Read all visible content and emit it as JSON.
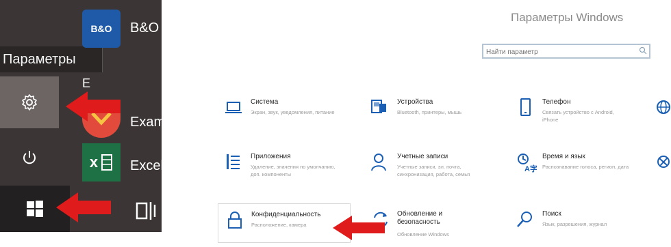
{
  "start_menu": {
    "tooltip": "Параметры",
    "tiles": [
      {
        "label": "B&O",
        "icon_text": "B&O"
      },
      {
        "label": "E"
      },
      {
        "label": "Exam"
      },
      {
        "label": "Excel",
        "icon_text": "x"
      }
    ],
    "icons": [
      "photo-icon",
      "gear-icon",
      "power-icon",
      "windows-icon",
      "taskbar-view-icon"
    ]
  },
  "settings": {
    "title": "Параметры Windows",
    "search_placeholder": "Найти параметр",
    "categories": [
      {
        "title": "Система",
        "desc": "Экран, звук, уведомления, питание",
        "icon": "laptop-icon"
      },
      {
        "title": "Устройства",
        "desc": "Bluetooth, принтеры, мышь",
        "icon": "devices-icon"
      },
      {
        "title": "Телефон",
        "desc": "Связать устройство с Android, iPhone",
        "icon": "phone-icon"
      },
      {
        "title": "Приложения",
        "desc": "Удаление, значения по умолчанию, доп. компоненты",
        "icon": "apps-icon"
      },
      {
        "title": "Учетные записи",
        "desc": "Учетные записи, эл. почта, синхронизация, работа, семья",
        "icon": "account-icon"
      },
      {
        "title": "Время и язык",
        "desc": "Распознавание голоса, регион, дата",
        "icon": "time-language-icon"
      },
      {
        "title": "Конфиденциальность",
        "desc": "Расположение, камера",
        "icon": "lock-icon"
      },
      {
        "title": "Обновление и безопасность",
        "desc": "Обновление Windows",
        "icon": "update-icon"
      },
      {
        "title": "Поиск",
        "desc": "Язык, разрешения, журнал",
        "icon": "search-icon"
      }
    ]
  },
  "colors": {
    "accent": "#1a5fb4",
    "arrow": "#e01b1b",
    "start_bg": "#3c3535"
  }
}
